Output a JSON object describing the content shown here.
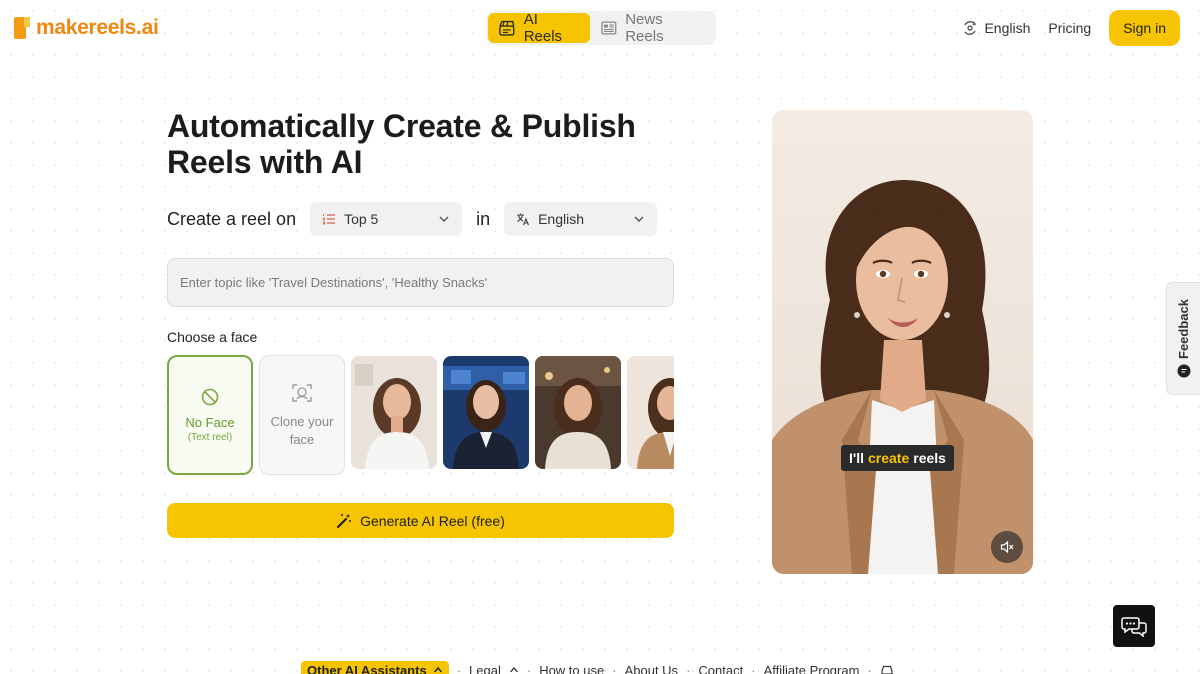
{
  "header": {
    "logo_text": "makereels.ai",
    "tabs": [
      {
        "label": "AI Reels",
        "active": true
      },
      {
        "label": "News Reels",
        "active": false
      }
    ],
    "language_label": "English",
    "pricing_label": "Pricing",
    "signin_label": "Sign in"
  },
  "hero": {
    "title": "Automatically Create & Publish Reels with AI",
    "create_label": "Create a reel on",
    "format_select": "Top 5",
    "in_label": "in",
    "language_select": "English",
    "topic_placeholder": "Enter topic like 'Travel Destinations', 'Healthy Snacks'",
    "choose_face_label": "Choose a face",
    "faces": {
      "no_face_title": "No Face",
      "no_face_sub": "(Text reel)",
      "clone_label": "Clone your face"
    },
    "generate_label": "Generate AI Reel (free)"
  },
  "preview": {
    "caption_before": "I'll",
    "caption_highlight": "create",
    "caption_after": "reels"
  },
  "feedback_label": "Feedback",
  "footer": {
    "other_assistants": "Other AI Assistants",
    "legal": "Legal",
    "how_to_use": "How to use",
    "about_us": "About Us",
    "contact": "Contact",
    "affiliate": "Affiliate Program"
  },
  "colors": {
    "accent": "#f6c400",
    "logo": "#f0870f",
    "selected_face_border": "#7aa742"
  }
}
